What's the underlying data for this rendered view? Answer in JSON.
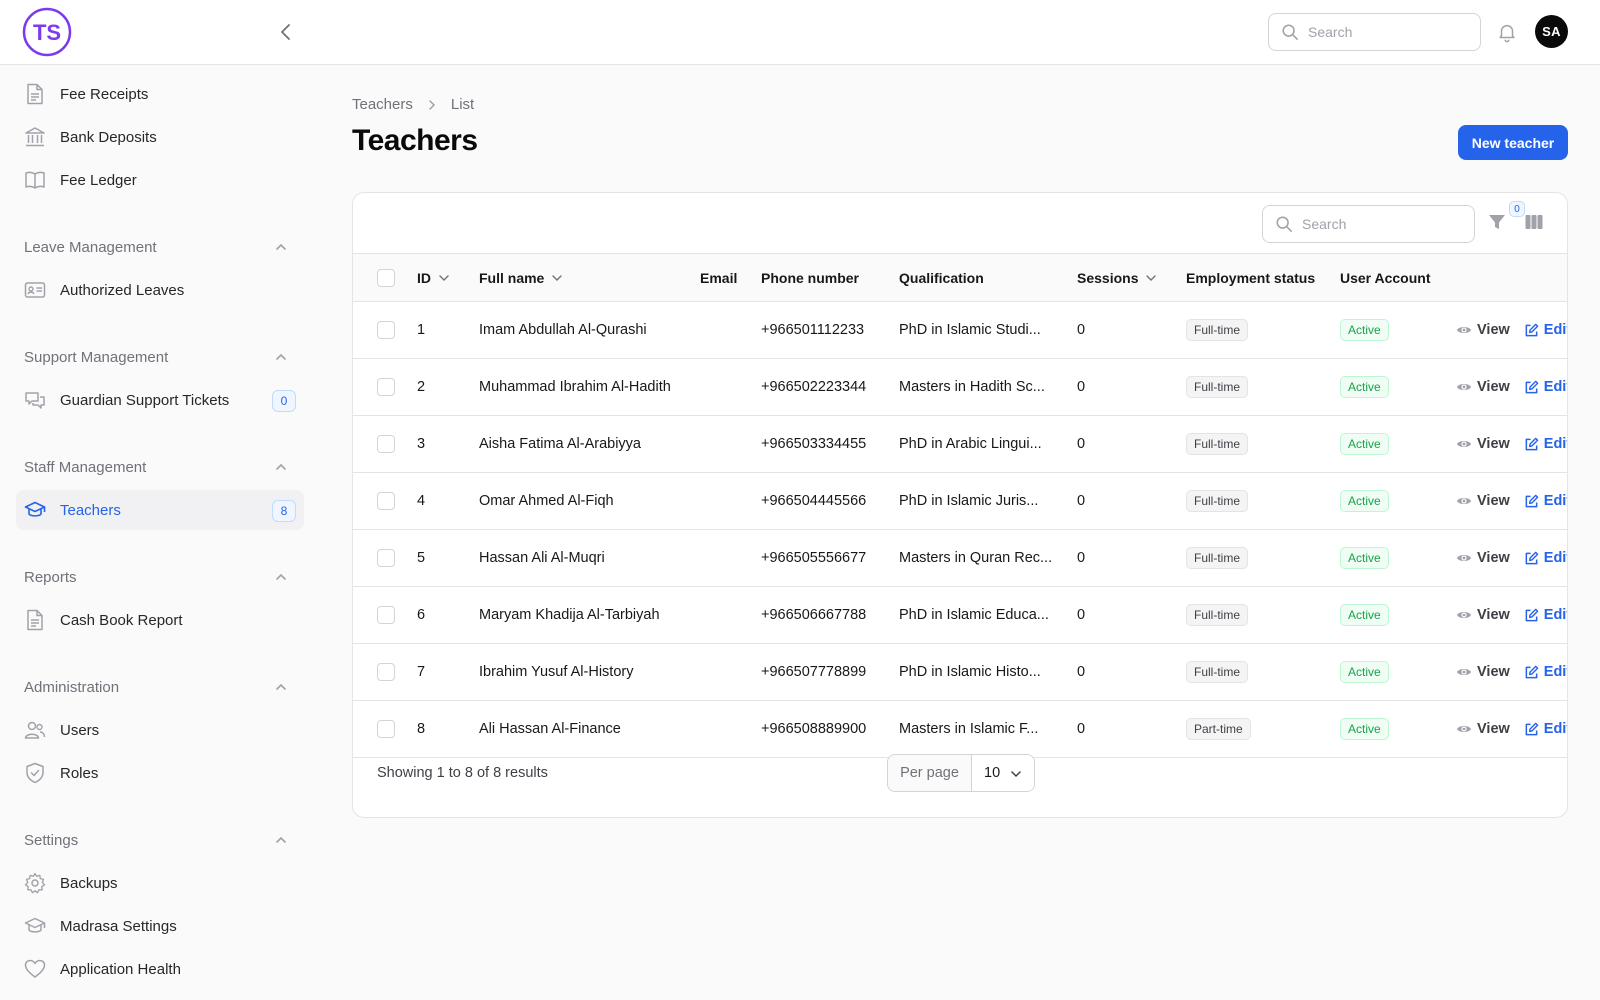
{
  "header": {
    "logo_text": "TS",
    "search_placeholder": "Search",
    "avatar_initials": "SA"
  },
  "sidebar": {
    "top_items": [
      {
        "label": "Fee Receipts",
        "icon": "document-icon"
      },
      {
        "label": "Bank Deposits",
        "icon": "bank-icon"
      },
      {
        "label": "Fee Ledger",
        "icon": "book-open-icon"
      }
    ],
    "groups": [
      {
        "label": "Leave Management",
        "items": [
          {
            "label": "Authorized Leaves",
            "icon": "id-card-icon"
          }
        ]
      },
      {
        "label": "Support Management",
        "items": [
          {
            "label": "Guardian Support Tickets",
            "icon": "chat-bubbles-icon",
            "badge": "0"
          }
        ]
      },
      {
        "label": "Staff Management",
        "items": [
          {
            "label": "Teachers",
            "icon": "academic-cap-icon",
            "badge": "8",
            "active": true
          }
        ]
      },
      {
        "label": "Reports",
        "items": [
          {
            "label": "Cash Book Report",
            "icon": "document-icon"
          }
        ]
      },
      {
        "label": "Administration",
        "items": [
          {
            "label": "Users",
            "icon": "users-icon"
          },
          {
            "label": "Roles",
            "icon": "shield-check-icon"
          }
        ]
      },
      {
        "label": "Settings",
        "items": [
          {
            "label": "Backups",
            "icon": "cog-icon"
          },
          {
            "label": "Madrasa Settings",
            "icon": "academic-cap-icon"
          },
          {
            "label": "Application Health",
            "icon": "heart-icon"
          }
        ]
      }
    ]
  },
  "main": {
    "breadcrumb": [
      "Teachers",
      "List"
    ],
    "title": "Teachers",
    "new_button": "New teacher",
    "table_search_placeholder": "Search",
    "filter_count": "0",
    "columns": {
      "id": "ID",
      "full_name": "Full name",
      "email": "Email",
      "phone": "Phone number",
      "qualification": "Qualification",
      "sessions": "Sessions",
      "employment_status": "Employment status",
      "user_account": "User Account"
    },
    "rows": [
      {
        "id": "1",
        "name": "Imam Abdullah Al-Qurashi",
        "email": "",
        "phone": "+966501112233",
        "qualification": "PhD in Islamic Studi...",
        "sessions": "0",
        "employment": "Full-time",
        "account": "Active",
        "view": "View",
        "edit": "Edit"
      },
      {
        "id": "2",
        "name": "Muhammad Ibrahim Al-Hadith",
        "email": "",
        "phone": "+966502223344",
        "qualification": "Masters in Hadith Sc...",
        "sessions": "0",
        "employment": "Full-time",
        "account": "Active",
        "view": "View",
        "edit": "Edit"
      },
      {
        "id": "3",
        "name": "Aisha Fatima Al-Arabiyya",
        "email": "",
        "phone": "+966503334455",
        "qualification": "PhD in Arabic Lingui...",
        "sessions": "0",
        "employment": "Full-time",
        "account": "Active",
        "view": "View",
        "edit": "Edit"
      },
      {
        "id": "4",
        "name": "Omar Ahmed Al-Fiqh",
        "email": "",
        "phone": "+966504445566",
        "qualification": "PhD in Islamic Juris...",
        "sessions": "0",
        "employment": "Full-time",
        "account": "Active",
        "view": "View",
        "edit": "Edit"
      },
      {
        "id": "5",
        "name": "Hassan Ali Al-Muqri",
        "email": "",
        "phone": "+966505556677",
        "qualification": "Masters in Quran Rec...",
        "sessions": "0",
        "employment": "Full-time",
        "account": "Active",
        "view": "View",
        "edit": "Edit"
      },
      {
        "id": "6",
        "name": "Maryam Khadija Al-Tarbiyah",
        "email": "",
        "phone": "+966506667788",
        "qualification": "PhD in Islamic Educa...",
        "sessions": "0",
        "employment": "Full-time",
        "account": "Active",
        "view": "View",
        "edit": "Edit"
      },
      {
        "id": "7",
        "name": "Ibrahim Yusuf Al-History",
        "email": "",
        "phone": "+966507778899",
        "qualification": "PhD in Islamic Histo...",
        "sessions": "0",
        "employment": "Full-time",
        "account": "Active",
        "view": "View",
        "edit": "Edit"
      },
      {
        "id": "8",
        "name": "Ali Hassan Al-Finance",
        "email": "",
        "phone": "+966508889900",
        "qualification": "Masters in Islamic F...",
        "sessions": "0",
        "employment": "Part-time",
        "account": "Active",
        "view": "View",
        "edit": "Edit"
      }
    ],
    "footer": {
      "showing": "Showing 1 to 8 of 8 results",
      "per_page_label": "Per page",
      "per_page_value": "10"
    }
  },
  "colors": {
    "accent": "#2563eb",
    "active_green": "#16a34a",
    "logo_purple": "#7c3aed"
  }
}
